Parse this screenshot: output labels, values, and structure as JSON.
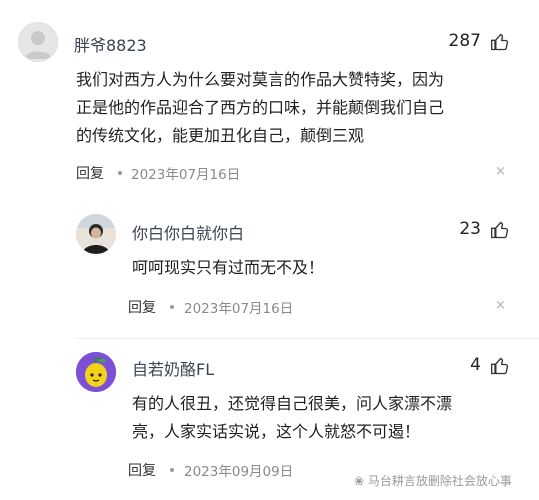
{
  "comments": [
    {
      "username": "胖爷8823",
      "likes": "287",
      "lines": [
        "我们对西方人为什么要对莫言的作品大赞特奖，因为",
        "正是他的作品迎合了西方的口味，并能颠倒我们自己",
        "的传统文化，能更加丑化自己，颠倒三观"
      ],
      "reply_label": "回复",
      "date": "2023年07月16日",
      "avatar": "default-avatar-icon"
    },
    {
      "username": "你白你白就你白",
      "likes": "23",
      "lines": [
        "呵呵现实只有过而无不及！"
      ],
      "reply_label": "回复",
      "date": "2023年07月16日",
      "avatar": "photo-avatar"
    },
    {
      "username": "自若奶酪FL",
      "likes": "4",
      "lines": [
        "有的人很丑，还觉得自己很美，问人家漂不漂",
        "亮，人家实话实说，这个人就怒不可遏！"
      ],
      "reply_label": "回复",
      "date": "2023年09月09日",
      "avatar": "lemon-avatar"
    }
  ],
  "close_symbol": "×",
  "watermark": "马台耕言放删除社会放心事",
  "colors": {
    "text": "#1f1f1f",
    "meta": "#8a8a8a",
    "divider": "#efefef",
    "avatar_purple": "#7b4fd6",
    "lemon": "#f2d21a"
  }
}
